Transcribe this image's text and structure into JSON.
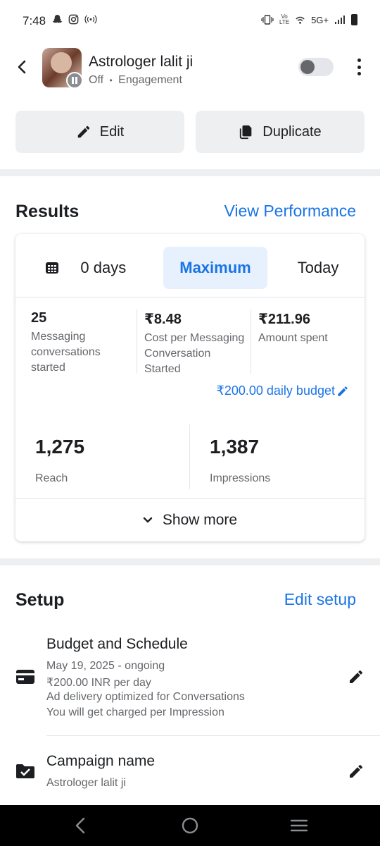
{
  "status_bar": {
    "time": "7:48",
    "network": "5G+",
    "left_icons": [
      "snapchat-icon",
      "instagram-icon",
      "hotspot-icon"
    ],
    "right_icons": [
      "vibrate-icon",
      "volte-icon",
      "wifi-icon",
      "signal-icon",
      "battery-icon"
    ]
  },
  "header": {
    "title": "Astrologer lalit ji",
    "status": "Off",
    "separator": "•",
    "objective": "Engagement",
    "toggle_on": false
  },
  "actions": {
    "edit_label": "Edit",
    "duplicate_label": "Duplicate"
  },
  "results": {
    "title": "Results",
    "link": "View Performance",
    "tabs": [
      {
        "label": " 0 days",
        "active": false
      },
      {
        "label": "Maximum",
        "active": true
      },
      {
        "label": "Today",
        "active": false
      }
    ],
    "metrics": [
      {
        "value": "25",
        "label_lines": [
          "Messaging",
          "conversations",
          "started"
        ]
      },
      {
        "value": "₹8.48",
        "label_lines": [
          "Cost per Messaging",
          "Conversation",
          "Started"
        ]
      },
      {
        "value": "₹211.96",
        "label_lines": [
          "Amount spent"
        ]
      }
    ],
    "budget_link": "₹200.00 daily budget",
    "reach": {
      "value": "1,275",
      "label": "Reach"
    },
    "impressions": {
      "value": "1,387",
      "label": "Impressions"
    },
    "show_more": "Show more"
  },
  "setup": {
    "title": "Setup",
    "link": "Edit setup",
    "budget": {
      "title": "Budget and Schedule",
      "lines": [
        "May 19, 2025 - ongoing",
        "₹200.00 INR per day",
        "Ad delivery optimized for Conversations",
        "You will get charged per Impression"
      ]
    },
    "campaign": {
      "title": "Campaign name",
      "value": "Astrologer lalit ji"
    }
  },
  "colors": {
    "accent": "#1a74e6",
    "secondary_text": "#65676b",
    "button_bg": "#eeeff1",
    "active_tab_bg": "#e7f0fd"
  }
}
